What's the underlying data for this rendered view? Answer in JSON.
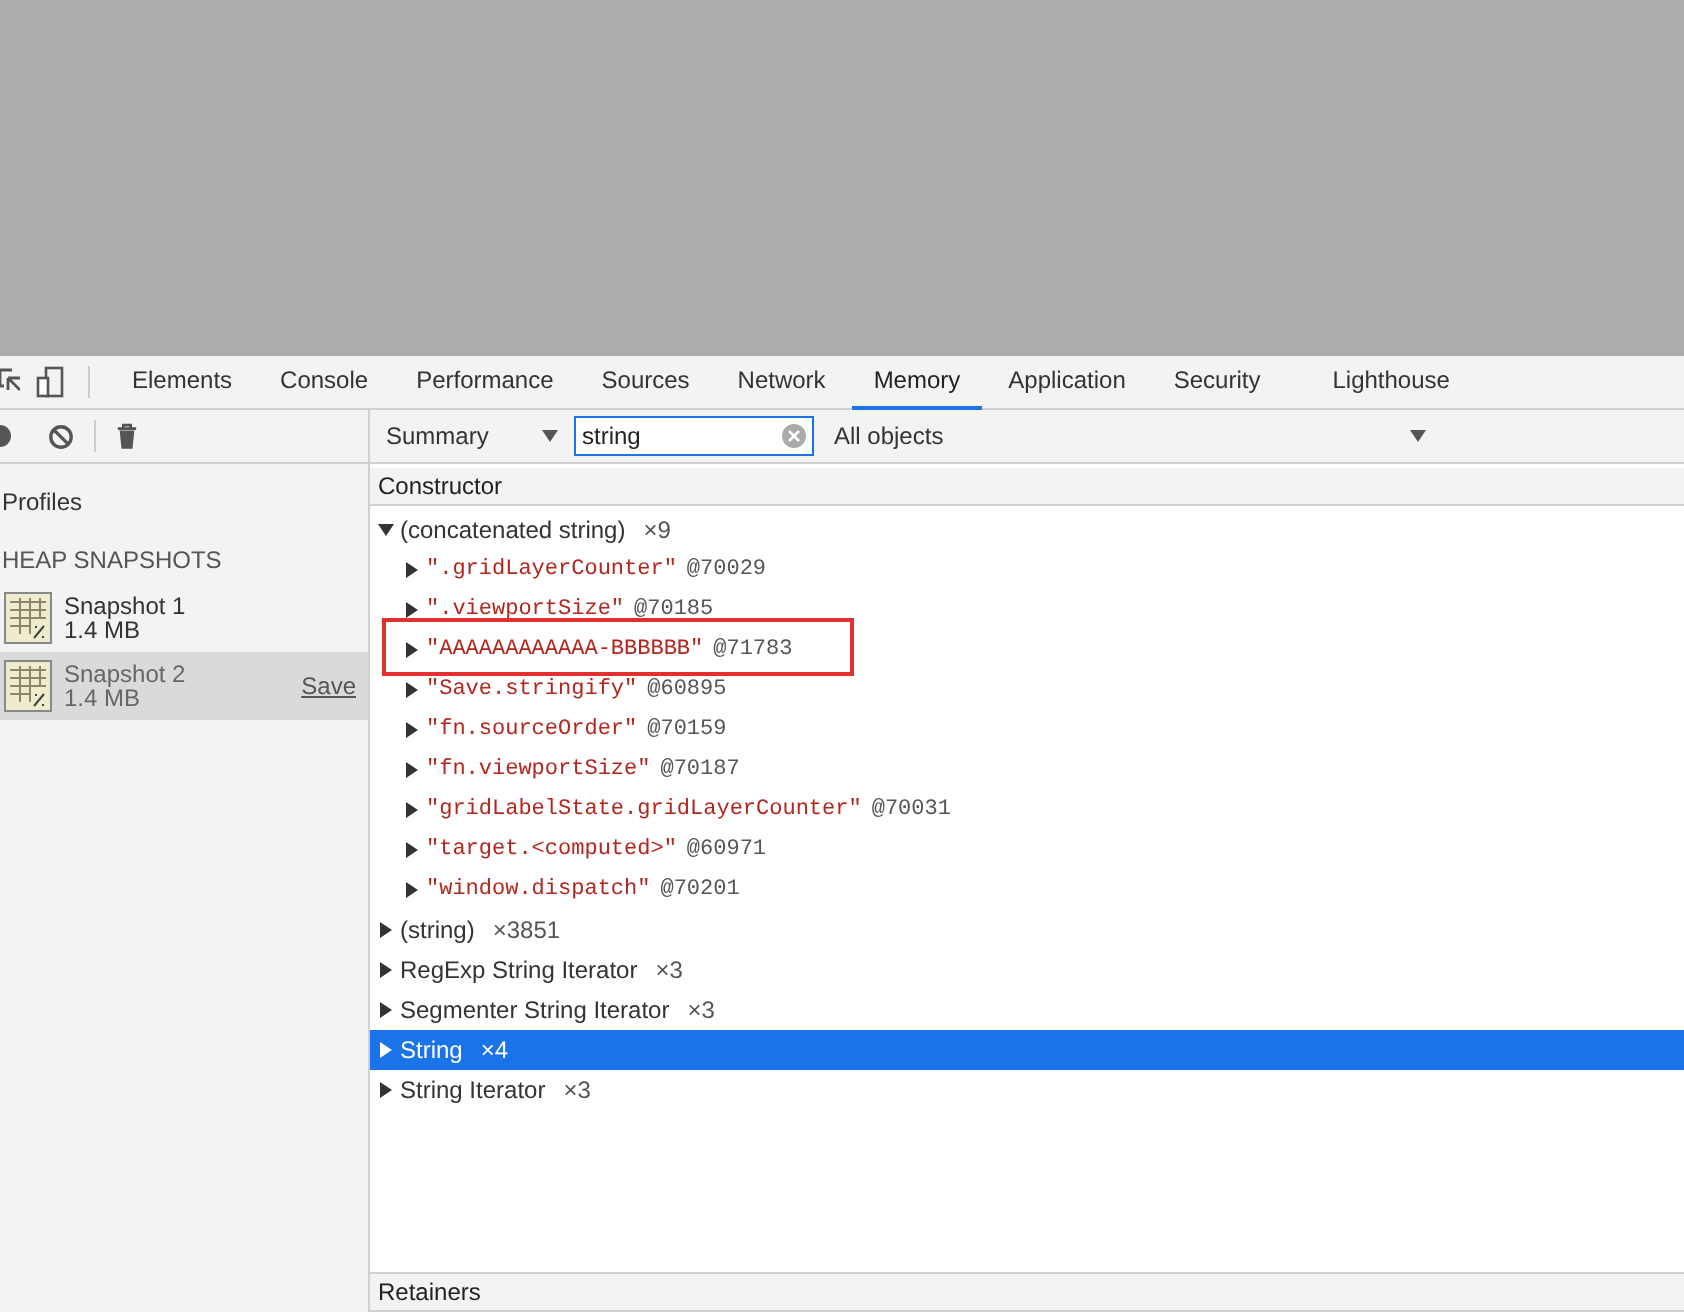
{
  "tabs": [
    {
      "label": "Elements",
      "selected": false
    },
    {
      "label": "Console",
      "selected": false
    },
    {
      "label": "Performance",
      "selected": false
    },
    {
      "label": "Sources",
      "selected": false
    },
    {
      "label": "Network",
      "selected": false
    },
    {
      "label": "Memory",
      "selected": true
    },
    {
      "label": "Application",
      "selected": false
    },
    {
      "label": "Security",
      "selected": false
    },
    {
      "label": "Lighthouse",
      "selected": false
    }
  ],
  "toolbar": {
    "view": "Summary",
    "filter": {
      "value": "string"
    },
    "class_filter": "All objects"
  },
  "sidebar": {
    "title": "Profiles",
    "section": "HEAP SNAPSHOTS",
    "snapshots": [
      {
        "name": "Snapshot 1",
        "size": "1.4 MB",
        "selected": false
      },
      {
        "name": "Snapshot 2",
        "size": "1.4 MB",
        "selected": true,
        "action": "Save"
      }
    ]
  },
  "table": {
    "column": "Constructor",
    "rows": [
      {
        "name": "(concatenated string)",
        "count": "×9",
        "expanded": true,
        "selected": false,
        "children": [
          {
            "value": "\".gridLayerCounter\"",
            "id": "@70029",
            "highlighted": false
          },
          {
            "value": "\".viewportSize\"",
            "id": "@70185",
            "highlighted": false
          },
          {
            "value": "\"AAAAAAAAAAAA-BBBBBB\"",
            "id": "@71783",
            "highlighted": true
          },
          {
            "value": "\"Save.stringify\"",
            "id": "@60895",
            "highlighted": false
          },
          {
            "value": "\"fn.sourceOrder\"",
            "id": "@70159",
            "highlighted": false
          },
          {
            "value": "\"fn.viewportSize\"",
            "id": "@70187",
            "highlighted": false
          },
          {
            "value": "\"gridLabelState.gridLayerCounter\"",
            "id": "@70031",
            "highlighted": false
          },
          {
            "value": "\"target.<computed>\"",
            "id": "@60971",
            "highlighted": false
          },
          {
            "value": "\"window.dispatch\"",
            "id": "@70201",
            "highlighted": false
          }
        ]
      },
      {
        "name": "(string)",
        "count": "×3851",
        "expanded": false,
        "selected": false
      },
      {
        "name": "RegExp String Iterator",
        "count": "×3",
        "expanded": false,
        "selected": false
      },
      {
        "name": "Segmenter String Iterator",
        "count": "×3",
        "expanded": false,
        "selected": false
      },
      {
        "name": "String",
        "count": "×4",
        "expanded": false,
        "selected": true
      },
      {
        "name": "String Iterator",
        "count": "×3",
        "expanded": false,
        "selected": false
      }
    ]
  },
  "retainers": {
    "title": "Retainers"
  }
}
